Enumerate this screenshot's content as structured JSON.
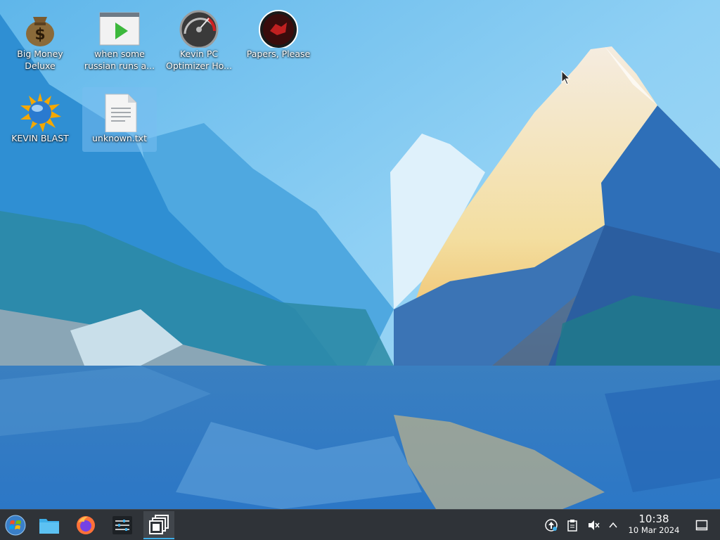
{
  "desktop": {
    "icons": [
      {
        "label": "Big Money\nDeluxe",
        "icon": "money-bag-icon"
      },
      {
        "label": "when some\nrussian runs a...",
        "icon": "video-play-icon"
      },
      {
        "label": "Kevin PC\nOptimizer Ho...",
        "icon": "speedometer-icon"
      },
      {
        "label": "Papers, Please",
        "icon": "papers-please-icon"
      },
      {
        "label": "KEVIN BLAST",
        "icon": "sun-globe-icon"
      },
      {
        "label": "unknown.txt",
        "icon": "text-file-icon"
      }
    ]
  },
  "taskbar": {
    "launchers": [
      "start-menu-icon",
      "file-manager-icon",
      "firefox-icon",
      "settings-icon"
    ],
    "active_task": "window-switcher-icon",
    "tray": [
      "update-icon",
      "clipboard-icon",
      "volume-muted-icon",
      "chevron-up-icon"
    ],
    "clock": {
      "time": "10:38",
      "date": "10 Mar 2024"
    },
    "show_desktop": "show-desktop-icon"
  },
  "colors": {
    "taskbar_bg": "#2f3338",
    "accent": "#3daee9",
    "selection": "#78bef0"
  }
}
